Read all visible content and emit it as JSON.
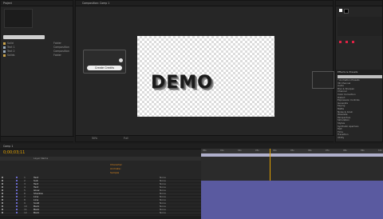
{
  "left_top_panel": {
    "tab": "Project"
  },
  "project_items": [
    {
      "name": "Solid",
      "kind": "Folder"
    },
    {
      "name": "Text 1",
      "kind": "Composition"
    },
    {
      "name": "Text 2",
      "kind": "Composition"
    },
    {
      "name": "Solids",
      "kind": "Folder"
    }
  ],
  "viewer": {
    "tab": "Composition: Comp 1",
    "canvas_text": "DEMO",
    "dialog_button": "Create Credits",
    "zoom": "50%",
    "resolution": "Full"
  },
  "right_panel": {
    "section_tab": "Effects & Presets",
    "search_placeholder": "",
    "preset_list": [
      "* Animation Presets",
      "3D Channel",
      "Audio",
      "Blur & Sharpen",
      "Channel",
      "Color Correction",
      "Distort",
      "Expression Controls",
      "Generate",
      "Keying",
      "Matte",
      "Noise & Grain",
      "Obsolete",
      "Perspective",
      "Simulation",
      "Stylize",
      "Synthetic Aperture",
      "Text",
      "Time",
      "Transition",
      "Utility"
    ]
  },
  "timeline": {
    "current_time": "0;00;03;11",
    "comp_tab": "Comp 1",
    "layer_header": "Layer Name",
    "ruler_labels": [
      "00s",
      "01s",
      "02s",
      "03s",
      "04s",
      "05s",
      "06s",
      "07s",
      "08s",
      "09s",
      "10s"
    ],
    "text_labels": [
      "Character",
      "Animate: ",
      "Sample"
    ],
    "layers": [
      {
        "num": "1",
        "name": "Text"
      },
      {
        "num": "2",
        "name": "Sub"
      },
      {
        "num": "3",
        "name": "Text"
      },
      {
        "num": "4",
        "name": "Text"
      },
      {
        "num": "5",
        "name": "Glow"
      },
      {
        "num": "6",
        "name": "Shadow"
      },
      {
        "num": "7",
        "name": "Line"
      },
      {
        "num": "8",
        "name": "Line"
      },
      {
        "num": "9",
        "name": "Solid"
      },
      {
        "num": "10",
        "name": "Back"
      },
      {
        "num": "11",
        "name": "Back"
      },
      {
        "num": "12",
        "name": "Back"
      }
    ],
    "parent_label": "None"
  },
  "colors": {
    "accent_orange": "#e38a1d",
    "layer_bar": "#5a5aa0",
    "work_area": "#b0b0cc",
    "timecode": "#e0a000"
  }
}
